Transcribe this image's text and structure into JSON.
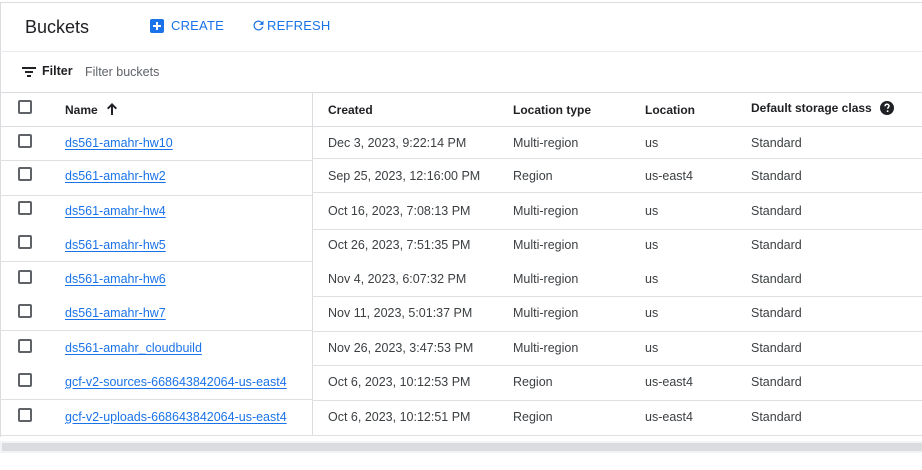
{
  "header": {
    "title": "Buckets",
    "create_label": "CREATE",
    "refresh_label": "REFRESH"
  },
  "filter": {
    "label": "Filter",
    "placeholder": "Filter buckets"
  },
  "table": {
    "columns": {
      "name": "Name",
      "created": "Created",
      "location_type": "Location type",
      "location": "Location",
      "storage_class": "Default storage class"
    },
    "rows": [
      {
        "name": "ds561-amahr-hw10",
        "created": "Dec 3, 2023, 9:22:14 PM",
        "location_type": "Multi-region",
        "location": "us",
        "storage_class": "Standard"
      },
      {
        "name": "ds561-amahr-hw2",
        "created": "Sep 25, 2023, 12:16:00 PM",
        "location_type": "Region",
        "location": "us-east4",
        "storage_class": "Standard"
      },
      {
        "name": "ds561-amahr-hw4",
        "created": "Oct 16, 2023, 7:08:13 PM",
        "location_type": "Multi-region",
        "location": "us",
        "storage_class": "Standard"
      },
      {
        "name": "ds561-amahr-hw5",
        "created": "Oct 26, 2023, 7:51:35 PM",
        "location_type": "Multi-region",
        "location": "us",
        "storage_class": "Standard"
      },
      {
        "name": "ds561-amahr-hw6",
        "created": "Nov 4, 2023, 6:07:32 PM",
        "location_type": "Multi-region",
        "location": "us",
        "storage_class": "Standard"
      },
      {
        "name": "ds561-amahr-hw7",
        "created": "Nov 11, 2023, 5:01:37 PM",
        "location_type": "Multi-region",
        "location": "us",
        "storage_class": "Standard"
      },
      {
        "name": "ds561-amahr_cloudbuild",
        "created": "Nov 26, 2023, 3:47:53 PM",
        "location_type": "Multi-region",
        "location": "us",
        "storage_class": "Standard"
      },
      {
        "name": "gcf-v2-sources-668643842064-us-east4",
        "created": "Oct 6, 2023, 10:12:53 PM",
        "location_type": "Region",
        "location": "us-east4",
        "storage_class": "Standard"
      },
      {
        "name": "gcf-v2-uploads-668643842064-us-east4",
        "created": "Oct 6, 2023, 10:12:51 PM",
        "location_type": "Region",
        "location": "us-east4",
        "storage_class": "Standard"
      }
    ]
  },
  "icons": {
    "create": "add-box-icon",
    "refresh": "refresh-icon",
    "filter": "filter-list-icon",
    "sort": "arrow-upward-icon",
    "help": "help-circle-icon"
  },
  "colors": {
    "accent": "#1a73e8",
    "text": "#202124",
    "divider": "#dadce0"
  }
}
